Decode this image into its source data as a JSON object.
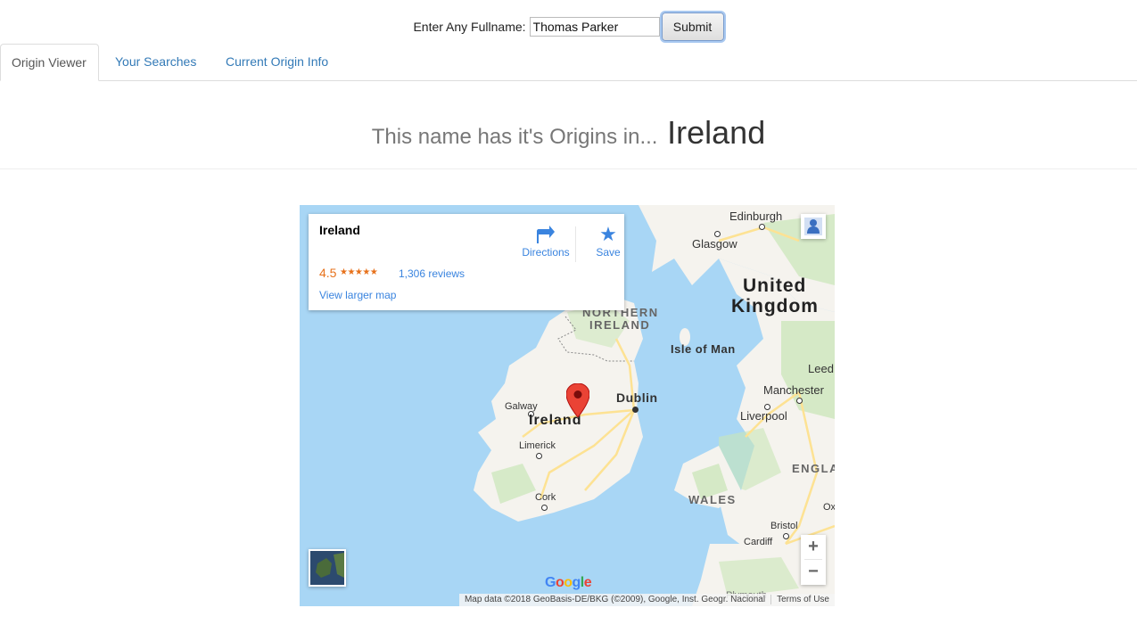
{
  "form": {
    "label": "Enter Any Fullname:",
    "name_value": "Thomas Parker",
    "submit_label": "Submit"
  },
  "tabs": [
    {
      "label": "Origin Viewer",
      "active": true
    },
    {
      "label": "Your Searches",
      "active": false
    },
    {
      "label": "Current Origin Info",
      "active": false
    }
  ],
  "result": {
    "prefix": "This name has it's Origins in...",
    "country": "Ireland"
  },
  "map": {
    "card": {
      "title": "Ireland",
      "rating": "4.5",
      "stars": "★★★★★",
      "reviews": "1,306 reviews",
      "view_larger": "View larger map",
      "directions_label": "Directions",
      "save_label": "Save"
    },
    "labels": {
      "edinburgh": "Edinburgh",
      "glasgow": "Glasgow",
      "united": "United",
      "kingdom": "Kingdom",
      "northern": "NORTHERN",
      "ireland_region": "IRELAND",
      "isle_of_man": "Isle of Man",
      "leeds": "Leed",
      "manchester": "Manchester",
      "liverpool": "Liverpool",
      "dublin": "Dublin",
      "galway": "Galway",
      "ireland": "Ireland",
      "limerick": "Limerick",
      "cork": "Cork",
      "england": "ENGLA",
      "wales": "WALES",
      "bristol": "Bristol",
      "cardiff": "Cardiff",
      "oxford": "Ox",
      "plymouth": "Plymouth"
    },
    "zoom_in": "+",
    "zoom_out": "−",
    "google_logo": "Google",
    "attribution": "Map data ©2018 GeoBasis-DE/BKG (©2009), Google, Inst. Geogr. Nacional",
    "terms": "Terms of Use",
    "colors": {
      "water": "#a8d6f5",
      "land": "#f5f3ee",
      "green": "#c9e6b8",
      "road": "#fde293",
      "pin": "#ea4335"
    }
  }
}
